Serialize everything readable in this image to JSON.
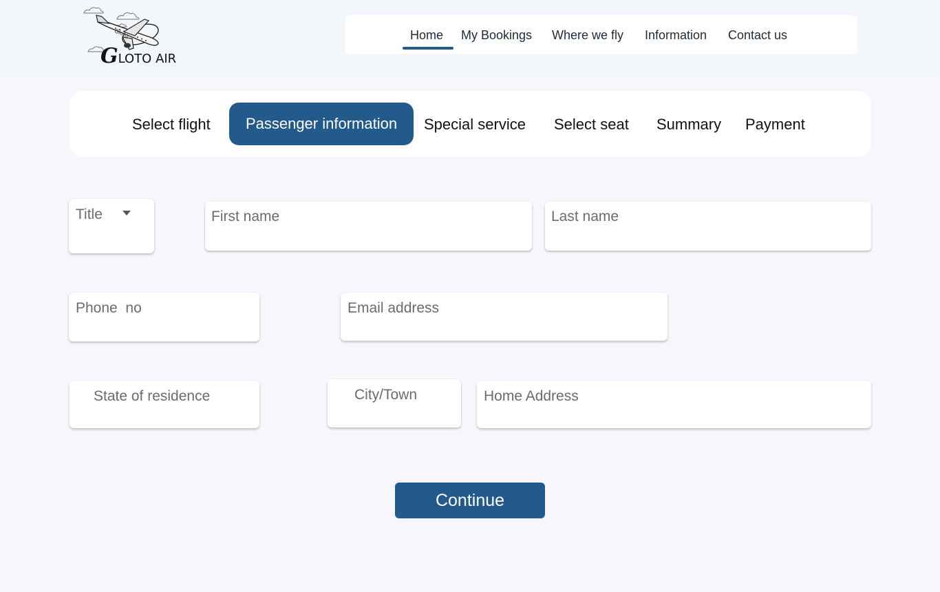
{
  "brand": {
    "logo_letter": "G",
    "logo_text": "LOTO AIR",
    "plane_text": "Gloto"
  },
  "nav": {
    "items": [
      {
        "label": "Home",
        "active": true
      },
      {
        "label": "My Bookings"
      },
      {
        "label": "Where we fly"
      },
      {
        "label": "Information"
      },
      {
        "label": "Contact us"
      }
    ]
  },
  "steps": {
    "items": [
      {
        "label": "Select flight"
      },
      {
        "label": "Passenger information",
        "active": true
      },
      {
        "label": "Special service"
      },
      {
        "label": "Select seat"
      },
      {
        "label": "Summary"
      },
      {
        "label": "Payment"
      }
    ]
  },
  "form": {
    "title": "Title",
    "first_name": "First name",
    "last_name": "Last name",
    "phone": "Phone  no",
    "email": "Email address",
    "state": "State of residence",
    "city": "City/Town",
    "address": "Home Address"
  },
  "actions": {
    "continue_label": "Continue"
  },
  "colors": {
    "primary": "#235a8c",
    "background": "#f7f6fc",
    "header_background": "#f3f6fa"
  }
}
